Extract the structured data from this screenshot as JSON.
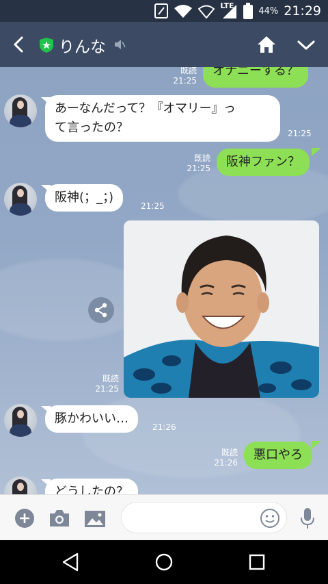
{
  "status_bar": {
    "network": "LTE",
    "battery": "44%",
    "time": "21:29"
  },
  "header": {
    "chat_name": "りんな"
  },
  "messages": [
    {
      "side": "out",
      "text": "オナニーする？",
      "read": "既読",
      "time": "21:25"
    },
    {
      "side": "in",
      "line1": "あーなんだって？『オマリー』っ",
      "line2": "て言ったの？",
      "time": "21:25"
    },
    {
      "side": "out",
      "text": "阪神ファン？",
      "read": "既読",
      "time": "21:25"
    },
    {
      "side": "in",
      "text": "阪神(；_；)",
      "time": "21:25"
    },
    {
      "side": "out",
      "type": "image",
      "read": "既読",
      "time": "21:25"
    },
    {
      "side": "in",
      "text": "豚かわいい…",
      "time": "21:26"
    },
    {
      "side": "out",
      "text": "悪口やろ",
      "read": "既読",
      "time": "21:26"
    },
    {
      "side": "in",
      "text": "どうしたの？"
    }
  ],
  "input": {
    "placeholder": ""
  },
  "colors": {
    "header": "#3c4a63",
    "status": "#273245",
    "out_bubble": "#8de055",
    "in_bubble": "#ffffff",
    "chat_bg": "#93a8c6"
  }
}
